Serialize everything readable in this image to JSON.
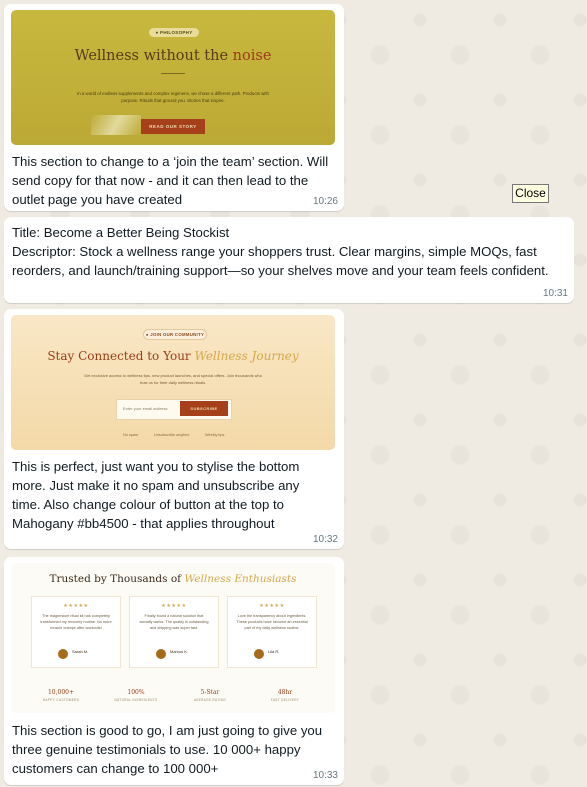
{
  "messages": [
    {
      "image": {
        "badge": "● PHILOSOPHY",
        "title_main": "Wellness without the ",
        "title_accent": "noise",
        "body": "In a world of endless supplements and complex regimens, we chose a different path. Products with purpose. Rituals that ground you. Stories that inspire.",
        "button": "READ OUR STORY"
      },
      "text": "This section to change to a ‘join the team’ section. Will send copy for that now - and it can then lead to the outlet page you have created",
      "time": "10:26"
    },
    {
      "text": "Title: Become a Better Being Stockist\nDescriptor: Stock a wellness range your shoppers trust. Clear margins, simple MOQs, fast reorders, and launch/training support—so your shelves move and your team feels confident.",
      "time": "10:31"
    },
    {
      "image": {
        "badge": "● JOIN OUR COMMUNITY",
        "title_main": "Stay Connected to Your ",
        "title_accent": "Wellness Journey",
        "body": "Get exclusive access to wellness tips, new product launches, and special offers. Join thousands who trust us for their daily wellness rituals.",
        "placeholder": "Enter your email address",
        "button": "SUBSCRIBE",
        "footnotes": [
          "No spam",
          "Unsubscribe anytime",
          "Weekly tips"
        ]
      },
      "text": "This is perfect, just want you to stylise the bottom more. Just make it no spam and unsubscribe any time. Also change colour of button at the top to Mahogany #bb4500 - that applies throughout",
      "time": "10:32"
    },
    {
      "image": {
        "title_main": "Trusted by Thousands of ",
        "title_accent": "Wellness Enthusiasts",
        "stars": "★★★★★",
        "testimonials": [
          {
            "quote": "The magnesium ritual kit has completely transformed my recovery routine. No more muscle cramps after workouts!",
            "name": "Sarah M."
          },
          {
            "quote": "Finally found a natural solution that actually works. The quality is outstanding and shipping was super fast.",
            "name": "Marcus K."
          },
          {
            "quote": "Love the transparency about ingredients. These products have become an essential part of my daily wellness routine.",
            "name": "Lila R."
          }
        ],
        "stats": [
          {
            "value": "10,000+",
            "label": "HAPPY CUSTOMERS"
          },
          {
            "value": "100%",
            "label": "NATURAL INGREDIENTS"
          },
          {
            "value": "5-Star",
            "label": "AVERAGE RATING"
          },
          {
            "value": "48hr",
            "label": "FAST DELIVERY"
          }
        ]
      },
      "text": "This section is good to go, I am just going to give you three genuine testimonials to use. 10 000+ happy customers can change to 100 000+",
      "time": "10:33"
    }
  ],
  "tooltip": {
    "label": "Close"
  },
  "colors": {
    "chat_bg": "#efeae2",
    "bubble_bg": "#ffffff",
    "mahogany": "#bb4500"
  }
}
